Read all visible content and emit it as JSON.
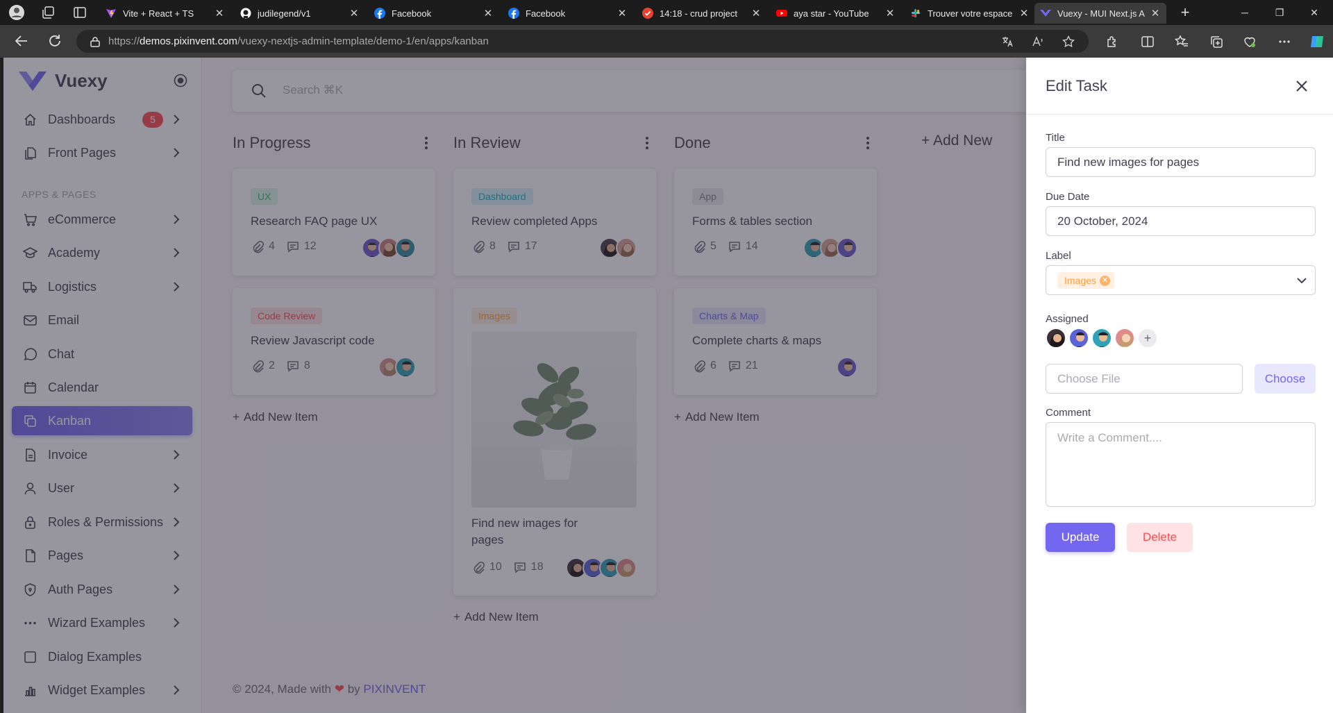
{
  "browser": {
    "tabs": [
      {
        "title": "Vite + React + TS",
        "favicon": "vite-icon",
        "color": "#a855f7"
      },
      {
        "title": "judilegend/v1",
        "favicon": "github-icon",
        "color": "#ffffff"
      },
      {
        "title": "Facebook",
        "favicon": "facebook-icon",
        "color": "#1877f2"
      },
      {
        "title": "Facebook",
        "favicon": "facebook-icon",
        "color": "#1877f2"
      },
      {
        "title": "14:18 - crud project",
        "favicon": "todo-check-icon",
        "color": "#e44232"
      },
      {
        "title": "aya star - YouTube",
        "favicon": "youtube-icon",
        "color": "#ff0000"
      },
      {
        "title": "Trouver votre espace",
        "favicon": "slack-icon",
        "color": "#e01e5a"
      },
      {
        "title": "Vuexy - MUI Next.js A",
        "favicon": "vuexy-icon",
        "color": "#7367f0"
      }
    ],
    "url_domain": "demos.pixinvent.com",
    "url_prefix": "https://",
    "url_path": "/vuexy-nextjs-admin-template/demo-1/en/apps/kanban"
  },
  "sidebar": {
    "brand": "Vuexy",
    "section_label": "APPS & PAGES",
    "items": [
      {
        "label": "Dashboards",
        "icon": "home-icon",
        "badge": "5",
        "chevron": true
      },
      {
        "label": "Front Pages",
        "icon": "files-icon",
        "chevron": true
      },
      {
        "label": "eCommerce",
        "icon": "shopping-cart-icon",
        "chevron": true
      },
      {
        "label": "Academy",
        "icon": "school-icon",
        "chevron": true
      },
      {
        "label": "Logistics",
        "icon": "truck-icon",
        "chevron": true
      },
      {
        "label": "Email",
        "icon": "mail-icon",
        "chevron": false
      },
      {
        "label": "Chat",
        "icon": "message-circle-icon",
        "chevron": false
      },
      {
        "label": "Calendar",
        "icon": "calendar-icon",
        "chevron": false
      },
      {
        "label": "Kanban",
        "icon": "copy-icon",
        "chevron": false,
        "active": true
      },
      {
        "label": "Invoice",
        "icon": "file-description-icon",
        "chevron": true
      },
      {
        "label": "User",
        "icon": "user-icon",
        "chevron": true
      },
      {
        "label": "Roles & Permissions",
        "icon": "lock-icon",
        "chevron": true
      },
      {
        "label": "Pages",
        "icon": "file-icon",
        "chevron": true
      },
      {
        "label": "Auth Pages",
        "icon": "shield-lock-icon",
        "chevron": true
      },
      {
        "label": "Wizard Examples",
        "icon": "dots-icon",
        "chevron": true
      },
      {
        "label": "Dialog Examples",
        "icon": "square-icon",
        "chevron": false
      },
      {
        "label": "Widget Examples",
        "icon": "chart-bar-icon",
        "chevron": true
      }
    ]
  },
  "search": {
    "placeholder": "Search ⌘K"
  },
  "board": {
    "add_new_label": "Add New",
    "add_item_label": "Add New Item",
    "columns": [
      {
        "title": "In Progress",
        "cards": [
          {
            "tag": "UX",
            "tag_color": "green",
            "title": "Research FAQ page UX",
            "attachments": "4",
            "comments": "12",
            "avatars": [
              "#6a5acd",
              "#c9807a",
              "#2f8f9d"
            ]
          },
          {
            "tag": "Code Review",
            "tag_color": "red",
            "title": "Review Javascript code",
            "attachments": "2",
            "comments": "8",
            "avatars": [
              "#d4918c",
              "#2fa3b5"
            ]
          }
        ]
      },
      {
        "title": "In Review",
        "cards": [
          {
            "tag": "Dashboard",
            "tag_color": "blue",
            "title": "Review completed Apps",
            "attachments": "8",
            "comments": "17",
            "avatars": [
              "#4a3f4a",
              "#d9a394"
            ]
          },
          {
            "tag": "Images",
            "tag_color": "orange",
            "title": "Find new images for pages",
            "attachments": "10",
            "comments": "18",
            "avatars": [
              "#3c3036",
              "#5b63d8",
              "#2fa3b5",
              "#e08a8a"
            ],
            "has_image": true
          }
        ]
      },
      {
        "title": "Done",
        "cards": [
          {
            "tag": "App",
            "tag_color": "grey",
            "title": "Forms & tables section",
            "attachments": "5",
            "comments": "14",
            "avatars": [
              "#2fa3b5",
              "#d9a394",
              "#6a5acd"
            ]
          },
          {
            "tag": "Charts & Map",
            "tag_color": "purple",
            "title": "Complete charts & maps",
            "attachments": "6",
            "comments": "21",
            "avatars": [
              "#6a5acd"
            ]
          }
        ]
      }
    ]
  },
  "footer": {
    "prefix": "© 2024, Made with",
    "by": "by",
    "company": "PIXINVENT"
  },
  "drawer": {
    "title": "Edit Task",
    "title_label": "Title",
    "title_value": "Find new images for pages",
    "due_label": "Due Date",
    "due_value": "20 October, 2024",
    "label_label": "Label",
    "label_chip": "Images",
    "assigned_label": "Assigned",
    "assigned_avatars": [
      "#3c3036",
      "#5b63d8",
      "#2fa3b5",
      "#e08a8a"
    ],
    "file_placeholder": "Choose File",
    "choose_button": "Choose",
    "comment_label": "Comment",
    "comment_placeholder": "Write a Comment....",
    "update_button": "Update",
    "delete_button": "Delete"
  },
  "colors": {
    "primary": "#7367f0",
    "danger": "#ff4c51",
    "warning": "#ff9f43",
    "success": "#28c76f",
    "info": "#00bad1"
  }
}
